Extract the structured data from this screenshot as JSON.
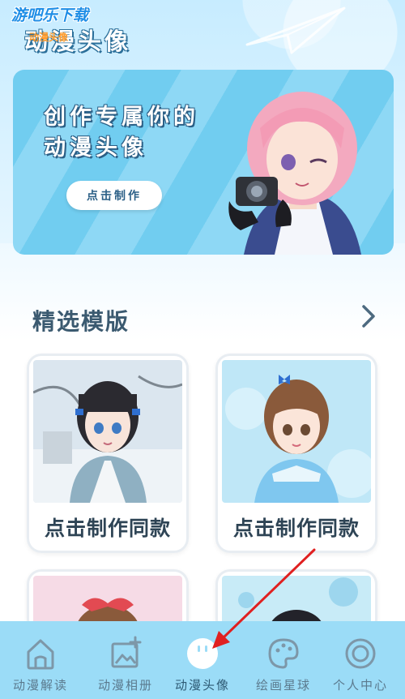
{
  "watermark": {
    "line1": "游吧乐下载",
    "line2": "动漫头像"
  },
  "page": {
    "title": "动漫头像"
  },
  "banner": {
    "title": "创作专属你的动漫头像",
    "button_label": "点击制作"
  },
  "section": {
    "title": "精选模版"
  },
  "templates": [
    {
      "label": "点击制作同款"
    },
    {
      "label": "点击制作同款"
    }
  ],
  "tabs": [
    {
      "label": "动漫解读",
      "icon": "house-icon"
    },
    {
      "label": "动漫相册",
      "icon": "photo-add-icon"
    },
    {
      "label": "动漫头像",
      "icon": "face-icon"
    },
    {
      "label": "绘画星球",
      "icon": "palette-icon"
    },
    {
      "label": "个人中心",
      "icon": "profile-ring-icon"
    }
  ],
  "colors": {
    "accent": "#9bdcf7",
    "banner": "#71cdf0",
    "title_text": "#3b5a70",
    "annotation_arrow": "#e02020"
  }
}
